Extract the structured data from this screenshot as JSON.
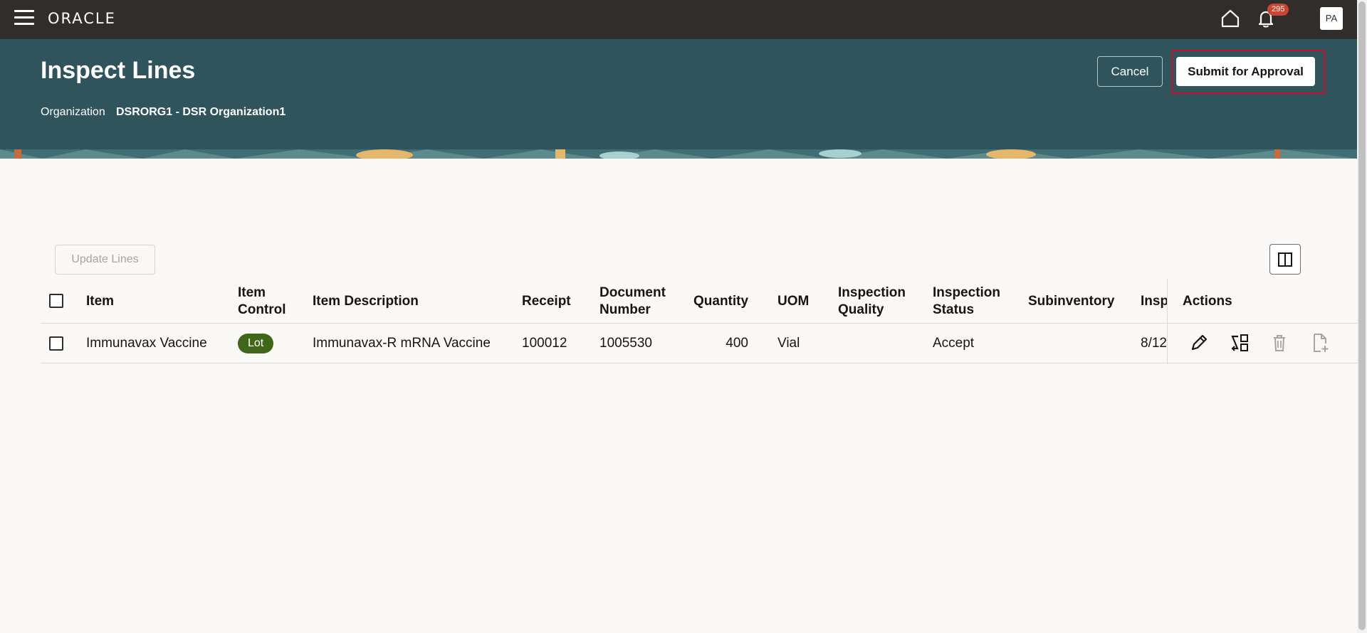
{
  "topbar": {
    "logo": "ORACLE",
    "notification_count": "295",
    "avatar_initials": "PA"
  },
  "header": {
    "title": "Inspect Lines",
    "organization_label": "Organization",
    "organization_value": "DSRORG1 - DSR Organization1",
    "cancel_label": "Cancel",
    "submit_label": "Submit for Approval"
  },
  "toolbar": {
    "update_lines_label": "Update Lines"
  },
  "table": {
    "columns": {
      "item": "Item",
      "item_control_1": "Item",
      "item_control_2": "Control",
      "item_description": "Item Description",
      "receipt": "Receipt",
      "document_number_1": "Document",
      "document_number_2": "Number",
      "quantity": "Quantity",
      "uom": "UOM",
      "inspection_quality_1": "Inspection",
      "inspection_quality_2": "Quality",
      "inspection_status_1": "Inspection",
      "inspection_status_2": "Status",
      "subinventory": "Subinventory",
      "inspection_date_truncated": "Insp",
      "actions": "Actions"
    },
    "rows": [
      {
        "item": "Immunavax Vaccine",
        "item_control": "Lot",
        "item_description": "Immunavax-R mRNA Vaccine",
        "receipt": "100012",
        "document_number": "1005530",
        "quantity": "400",
        "uom": "Vial",
        "inspection_quality": "",
        "inspection_status": "Accept",
        "subinventory": "",
        "inspection_date_truncated": "8/12"
      }
    ]
  },
  "colors": {
    "topbar": "#312d2a",
    "header": "#30545b",
    "lot_badge": "#406619",
    "notification_badge": "#c74634",
    "highlight": "#c8102e"
  }
}
